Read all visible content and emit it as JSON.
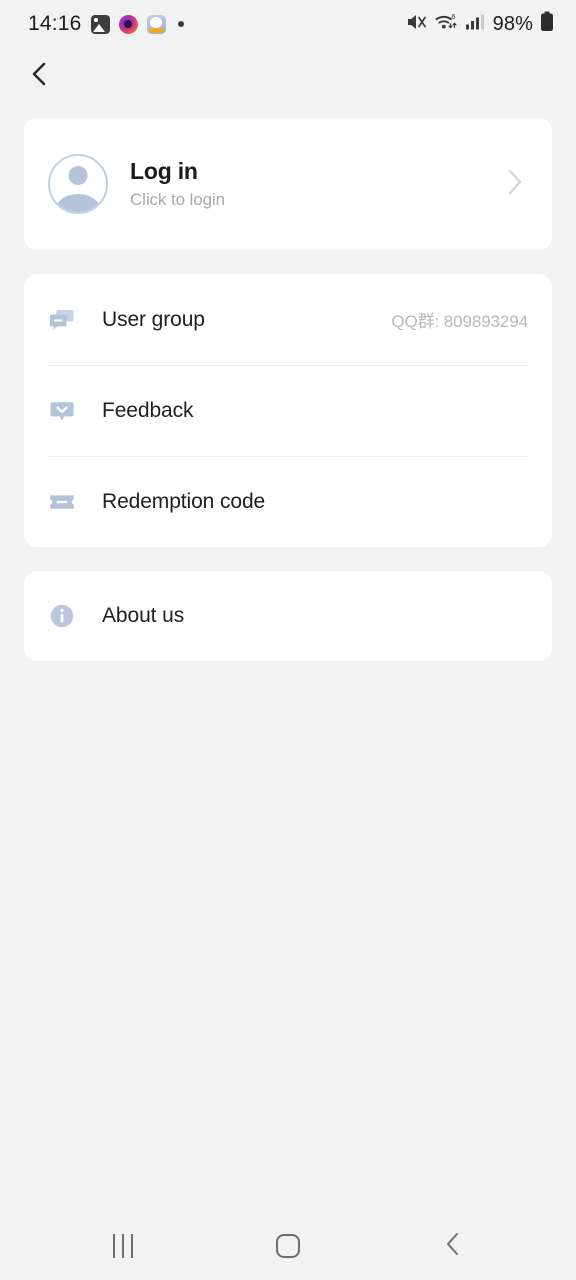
{
  "status_bar": {
    "time": "14:16",
    "app_icons": [
      "photos-icon",
      "camera-icon",
      "cat-app-icon",
      "notification-dot-icon"
    ],
    "mute_icon": "volume-mute-icon",
    "wifi_icon": "wifi-6-icon",
    "signal_icon": "cellular-signal-icon",
    "battery_percent": "98%",
    "battery_icon": "battery-full-icon"
  },
  "header": {
    "back_icon": "chevron-left-icon"
  },
  "login_card": {
    "avatar_icon": "user-avatar-icon",
    "title": "Log in",
    "subtitle": "Click to login",
    "chevron_icon": "chevron-right-icon"
  },
  "menu_card": {
    "items": [
      {
        "icon": "chat-bubbles-icon",
        "label": "User group",
        "value": "QQ群: 809893294"
      },
      {
        "icon": "feedback-bubble-icon",
        "label": "Feedback",
        "value": ""
      },
      {
        "icon": "ticket-icon",
        "label": "Redemption code",
        "value": ""
      }
    ]
  },
  "about_card": {
    "items": [
      {
        "icon": "info-circle-icon",
        "label": "About us",
        "value": ""
      }
    ]
  },
  "nav_bar": {
    "recents_icon": "recents-icon",
    "home_icon": "home-icon",
    "back_icon": "nav-back-icon"
  },
  "colors": {
    "page_background": "#f2f2f2",
    "card_background": "#ffffff",
    "icon_tint": "#b3c3da",
    "primary_text": "#1b1b1b",
    "secondary_text": "#b9b9b9"
  }
}
